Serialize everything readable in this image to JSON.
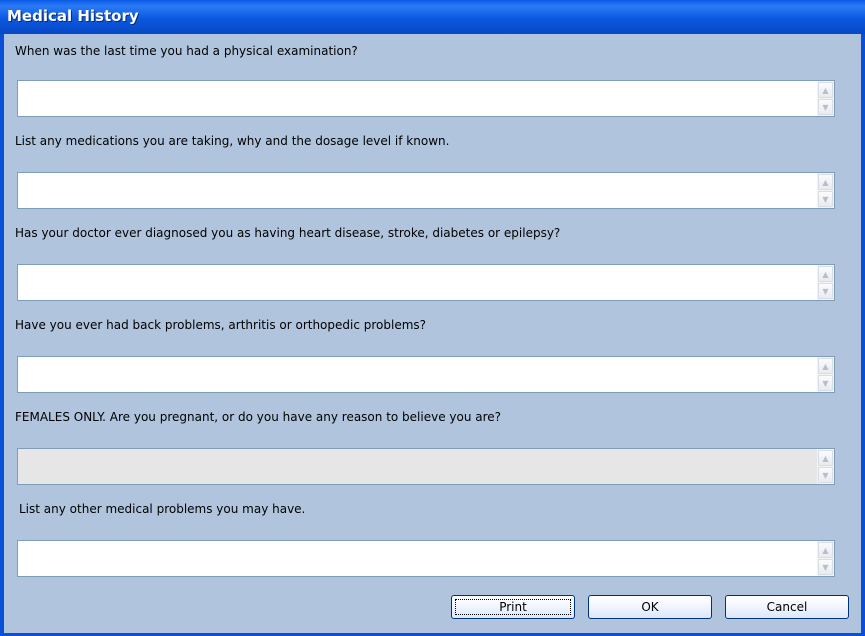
{
  "window": {
    "title": "Medical History"
  },
  "questions": [
    {
      "label": "When was the last time you had a physical examination?",
      "value": "",
      "enabled": true
    },
    {
      "label": "List any medications you are taking, why and the dosage level if known.",
      "value": "",
      "enabled": true
    },
    {
      "label": "Has your doctor ever diagnosed you as having heart disease, stroke, diabetes or epilepsy?",
      "value": "",
      "enabled": true
    },
    {
      "label": "Have you ever had back problems, arthritis or orthopedic problems?",
      "value": "",
      "enabled": true
    },
    {
      "label": "FEMALES ONLY.  Are you pregnant, or do you have any reason to believe you are?",
      "value": "",
      "enabled": false
    },
    {
      "label": "List any other medical problems you may have.",
      "value": "",
      "enabled": true
    }
  ],
  "buttons": {
    "print": "Print",
    "ok": "OK",
    "cancel": "Cancel"
  },
  "icons": {
    "scroll_up": "scroll-up-arrow-icon",
    "scroll_down": "scroll-down-arrow-icon"
  },
  "colors": {
    "titlebar": "#0a58e0",
    "client": "#b0c4de",
    "field_border": "#7f9db9"
  }
}
